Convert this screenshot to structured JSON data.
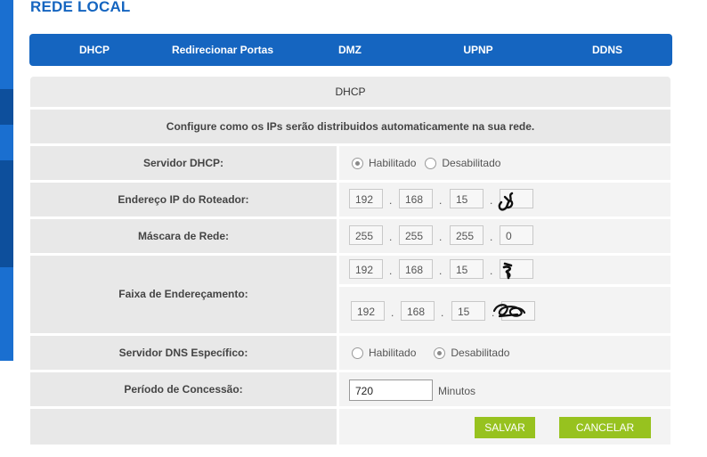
{
  "page": {
    "title": "REDE LOCAL"
  },
  "tabs": [
    "DHCP",
    "Redirecionar Portas",
    "DMZ",
    "UPNP",
    "DDNS"
  ],
  "section": {
    "title": "DHCP",
    "description": "Configure como os IPs serão distribuidos automaticamente na sua rede."
  },
  "fields": {
    "dhcp_server": {
      "label": "Servidor DHCP:",
      "options": [
        "Habilitado",
        "Desabilitado"
      ],
      "selected": "Habilitado"
    },
    "router_ip": {
      "label": "Endereço IP do Roteador:",
      "octets": [
        "192",
        "168",
        "15",
        ""
      ]
    },
    "netmask": {
      "label": "Máscara de Rede:",
      "octets": [
        "255",
        "255",
        "255",
        "0"
      ]
    },
    "address_range": {
      "label": "Faixa de Endereçamento:",
      "start": [
        "192",
        "168",
        "15",
        ""
      ],
      "end": [
        "192",
        "168",
        "15",
        ""
      ]
    },
    "dns_server": {
      "label": "Servidor DNS Específico:",
      "options": [
        "Habilitado",
        "Desabilitado"
      ],
      "selected": "Desabilitado"
    },
    "lease": {
      "label": "Período de Concessão:",
      "value": "720",
      "unit": "Minutos"
    }
  },
  "buttons": {
    "save": "SALVAR",
    "cancel": "CANCELAR"
  },
  "colors": {
    "brand_blue": "#1565c0",
    "button_green": "#97c21f"
  }
}
